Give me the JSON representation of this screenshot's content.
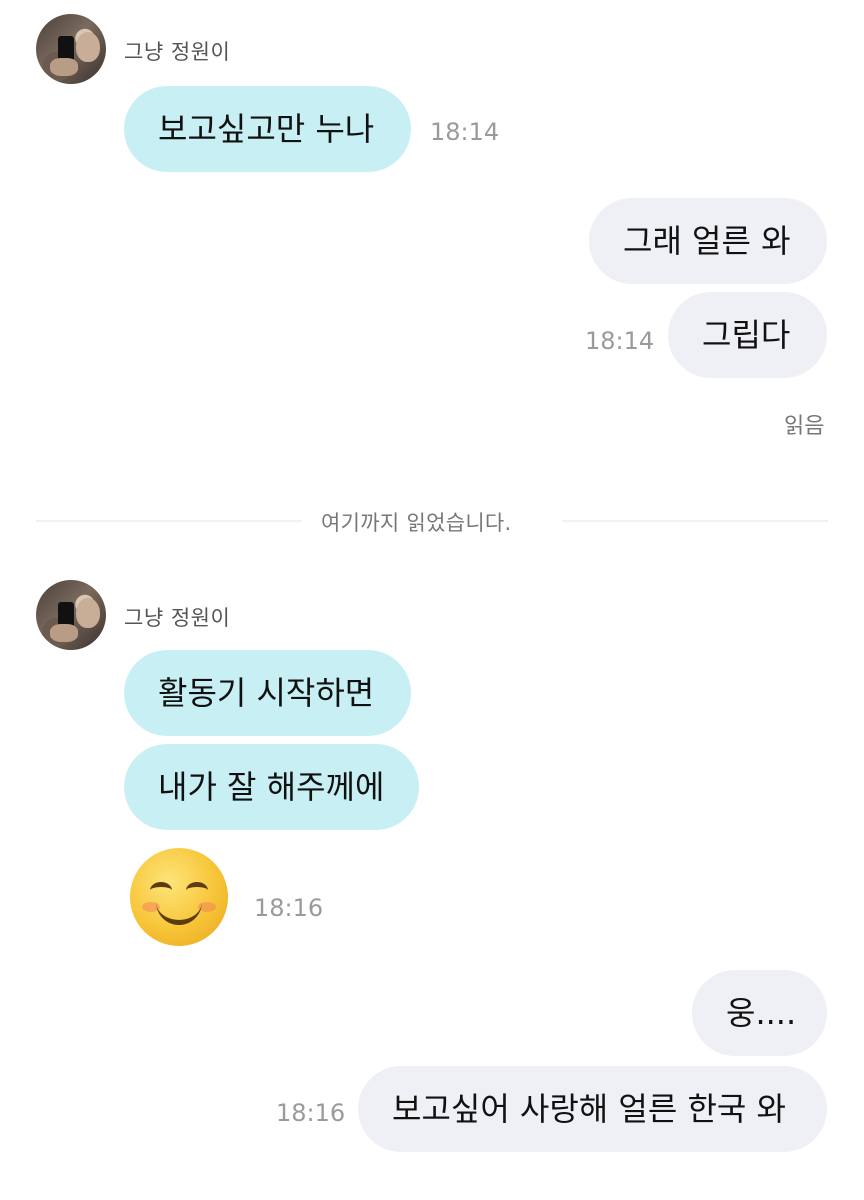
{
  "chat": {
    "sender_name_1": "그냥 정원이",
    "sender_name_2": "그냥 정원이",
    "messages": [
      {
        "text": "보고싶고만 누나",
        "time": "18:14"
      },
      {
        "text": "그래 얼른 와"
      },
      {
        "text": "그립다",
        "time": "18:14"
      },
      {
        "text": "활동기 시작하면"
      },
      {
        "text": "내가 잘 해주께에"
      },
      {
        "emoji": "smiling-face-with-smiling-eyes",
        "time": "18:16"
      },
      {
        "text": "웅...."
      },
      {
        "text": "보고싶어 사랑해 얼른 한국 와",
        "time": "18:16"
      }
    ],
    "read_status": "읽음",
    "divider_text": "여기까지 읽었습니다."
  },
  "colors": {
    "incoming_bubble": "#c8f0f4",
    "outgoing_bubble": "#eff0f5",
    "time_text": "#9a9a9a"
  }
}
